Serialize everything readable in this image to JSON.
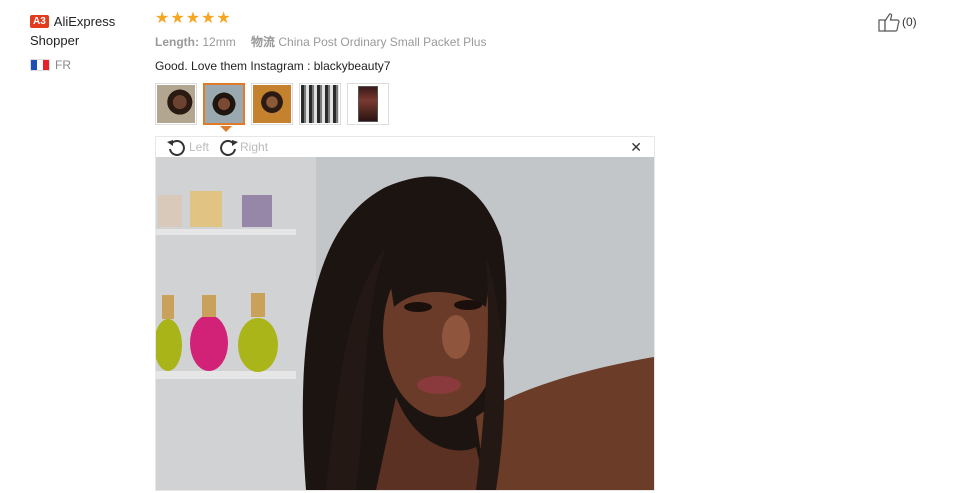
{
  "user": {
    "badge": "A3",
    "name": "AliExpress Shopper",
    "country_code": "FR",
    "flag_colors": [
      "#1c4fb8",
      "#ffffff",
      "#e8202a"
    ]
  },
  "feedback": {
    "rating": 5,
    "star_color": "#f5a623",
    "attributes": [
      {
        "key": "Length:",
        "value": "12mm"
      },
      {
        "key": "物流",
        "value": "China Post Ordinary Small Packet Plus"
      }
    ],
    "comment": "Good. Love them Instagram : blackybeauty7",
    "thumbnails": [
      {
        "name": "photo-1",
        "selected": false
      },
      {
        "name": "photo-2",
        "selected": true
      },
      {
        "name": "photo-3",
        "selected": false
      },
      {
        "name": "photo-4",
        "selected": false
      },
      {
        "name": "photo-5",
        "selected": false
      }
    ],
    "selected_color": "#e07b2a"
  },
  "viewer": {
    "rotate_left_label": "Left",
    "rotate_right_label": "Right",
    "close_icon": "close-icon"
  },
  "like": {
    "count": "(0)",
    "icon": "thumbs-up-icon"
  }
}
